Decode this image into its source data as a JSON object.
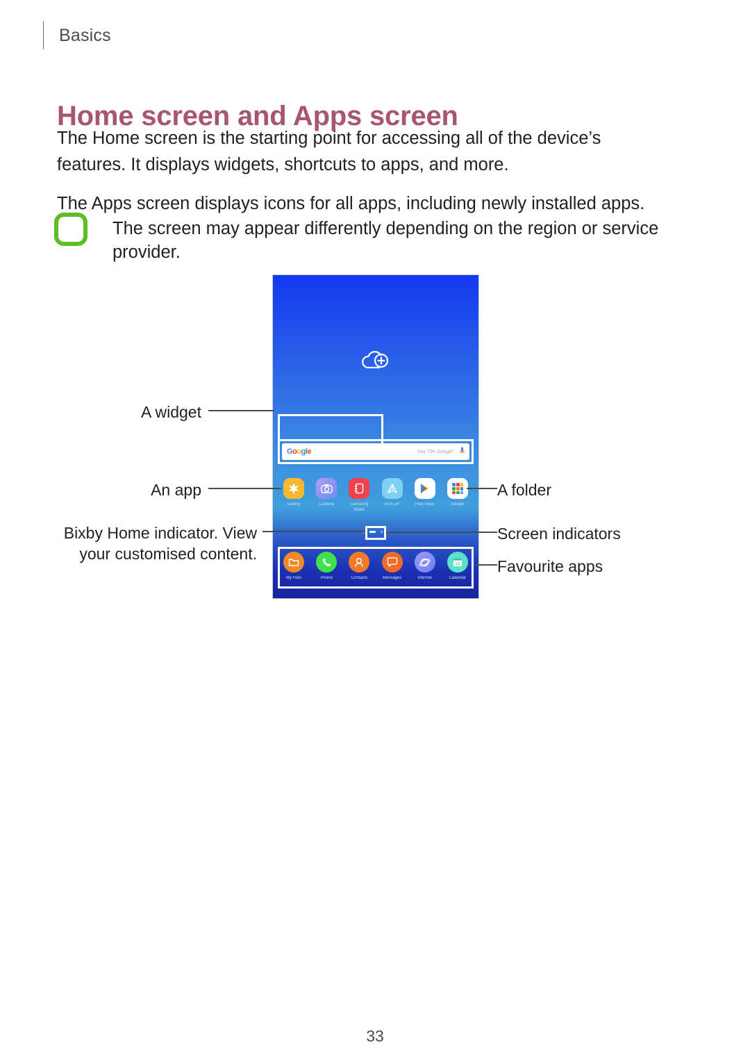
{
  "running_head": {
    "label": "Basics",
    "divider": "vertical-rule"
  },
  "heading": "Home screen and Apps screen",
  "paragraphs": [
    "The Home screen is the starting point for accessing all of the device’s features. It displays widgets, shortcuts to apps, and more.",
    "The Apps screen displays icons for all apps, including newly installed apps."
  ],
  "note": {
    "icon": "samsung-note-pen-icon",
    "icon_color": "#5fbd24",
    "text": "The screen may appear differently depending on the region or service provider."
  },
  "figure": {
    "device_screen": {
      "wallpaper_gradient_top": "#1438f0",
      "wallpaper_gradient_bottom": "#18249c",
      "status_icon": "cloud-plus-icon"
    },
    "search_widget": {
      "logo": "Google",
      "logo_letters": [
        "G",
        "o",
        "o",
        "g",
        "l",
        "e"
      ],
      "hint": "Say “OK Google”",
      "mic_icon": "microphone-icon"
    },
    "app_row": [
      {
        "name": "Gallery",
        "icon": "gallery-icon",
        "color": "#f7b731"
      },
      {
        "name": "Camera",
        "icon": "camera-icon",
        "color": "#8e8bf0"
      },
      {
        "name": "Samsung\nNotes",
        "icon": "samsung-notes-icon",
        "color": "#f0414d"
      },
      {
        "name": "PEN.UP",
        "icon": "penup-icon",
        "color": "#7fd0f2"
      },
      {
        "name": "Play Store",
        "icon": "play-store-icon",
        "color": "#ffffff"
      },
      {
        "name": "Google",
        "icon": "google-folder-icon",
        "color": "#ffffff"
      }
    ],
    "dock_apps": [
      {
        "name": "My Files",
        "icon": "my-files-icon",
        "color": "#f08a28"
      },
      {
        "name": "Phone",
        "icon": "phone-icon",
        "color": "#42e04a"
      },
      {
        "name": "Contacts",
        "icon": "contacts-icon",
        "color": "#f07a28"
      },
      {
        "name": "Messages",
        "icon": "messages-icon",
        "color": "#f26a28"
      },
      {
        "name": "Internet",
        "icon": "internet-icon",
        "color": "#8a8bf5"
      },
      {
        "name": "Calendar",
        "icon": "calendar-icon",
        "color": "#5fe0c8",
        "badge": "19"
      }
    ],
    "page_indicator_dots": 5,
    "page_indicator_active": 2,
    "callouts": {
      "left": [
        "A widget",
        "An app",
        "Bixby Home indicator. View\nyour customised content."
      ],
      "right": [
        "A folder",
        "Screen indicators",
        "Favourite apps"
      ]
    }
  },
  "page_number": "33"
}
